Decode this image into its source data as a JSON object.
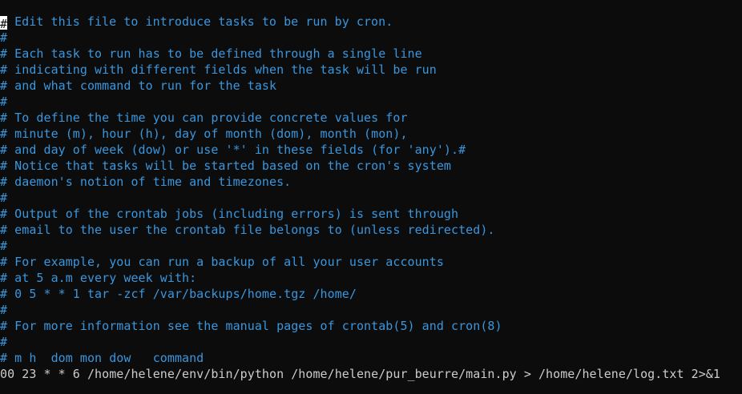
{
  "editor": {
    "first_line_rest": " Edit this file to introduce tasks to be run by cron.",
    "cursor_char": "#",
    "comment_lines": [
      "#",
      "# Each task to run has to be defined through a single line",
      "# indicating with different fields when the task will be run",
      "# and what command to run for the task",
      "#",
      "# To define the time you can provide concrete values for",
      "# minute (m), hour (h), day of month (dom), month (mon),",
      "# and day of week (dow) or use '*' in these fields (for 'any').#",
      "# Notice that tasks will be started based on the cron's system",
      "# daemon's notion of time and timezones.",
      "#",
      "# Output of the crontab jobs (including errors) is sent through",
      "# email to the user the crontab file belongs to (unless redirected).",
      "#",
      "# For example, you can run a backup of all your user accounts",
      "# at 5 a.m every week with:",
      "# 0 5 * * 1 tar -zcf /var/backups/home.tgz /home/",
      "#",
      "# For more information see the manual pages of crontab(5) and cron(8)",
      "#",
      "# m h  dom mon dow   command"
    ],
    "job_line": "00 23 * * 6 /home/helene/env/bin/python /home/helene/pur_beurre/main.py > /home/helene/log.txt 2>&1"
  },
  "colors": {
    "background": "#0c0c0c",
    "comment": "#3a96dd",
    "code": "#cccccc",
    "cursor": "#ffffff"
  }
}
